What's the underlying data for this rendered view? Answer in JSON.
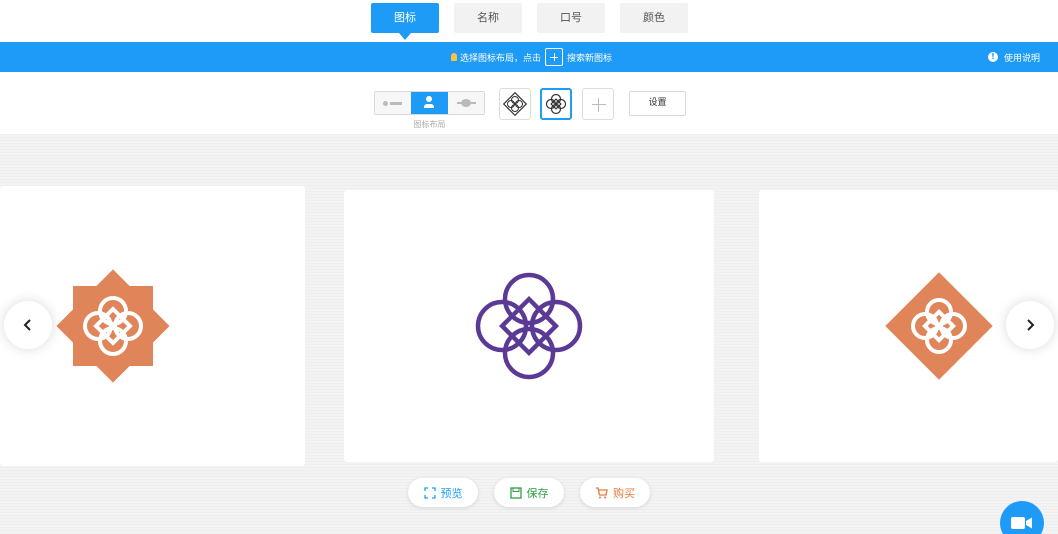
{
  "tabs": [
    {
      "label": "图标",
      "active": true
    },
    {
      "label": "名称",
      "active": false
    },
    {
      "label": "口号",
      "active": false
    },
    {
      "label": "颜色",
      "active": false
    }
  ],
  "notice": {
    "text_before": "选择图标布局，点击",
    "text_after": "搜索新图标",
    "help_label": "使用说明"
  },
  "toolbar": {
    "layout_caption": "图标布局",
    "settings_label": "设置"
  },
  "actions": {
    "preview_label": "预览",
    "save_label": "保存",
    "buy_label": "购买"
  },
  "colors": {
    "accent": "#1e9bf7",
    "logo_orange": "#e0855a",
    "logo_purple": "#5b3a96",
    "save_green": "#2f9e44",
    "buy_orange": "#e07a3a"
  },
  "icons": {
    "nav_prev": "chevron-left-icon",
    "nav_next": "chevron-right-icon",
    "help": "info-icon",
    "camera": "video-camera-icon"
  }
}
